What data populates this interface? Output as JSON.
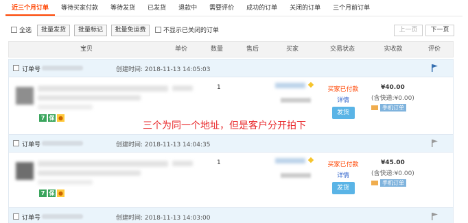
{
  "tabs": [
    {
      "label": "近三个月订单",
      "active": true
    },
    {
      "label": "等待买家付款",
      "active": false
    },
    {
      "label": "等待发货",
      "active": false
    },
    {
      "label": "已发货",
      "active": false
    },
    {
      "label": "退款中",
      "active": false
    },
    {
      "label": "需要评价",
      "active": false
    },
    {
      "label": "成功的订单",
      "active": false
    },
    {
      "label": "关闭的订单",
      "active": false
    },
    {
      "label": "三个月前订单",
      "active": false
    }
  ],
  "toolbar": {
    "select_all": "全选",
    "batch_ship": "批量发货",
    "batch_mark": "批量标记",
    "batch_free_shipping": "批量免运费",
    "hide_closed": "不显示已关闭的订单",
    "prev_page": "上一页",
    "next_page": "下一页"
  },
  "columns": [
    "宝贝",
    "单价",
    "数量",
    "售后",
    "买家",
    "交易状态",
    "实收款",
    "评价"
  ],
  "orders": [
    {
      "order_label": "订单号",
      "created": "创建时间: 2018-11-13 14:05:03",
      "qty": "1",
      "status": "买家已付款",
      "detail": "详情",
      "ship": "发货",
      "amount": "¥40.00",
      "postage": "(含快递:¥0.00)",
      "phone_order": "手机订单"
    },
    {
      "order_label": "订单号",
      "created": "创建时间: 2018-11-13 14:04:35",
      "qty": "1",
      "status": "买家已付款",
      "detail": "详情",
      "ship": "发货",
      "amount": "¥45.00",
      "postage": "(含快递:¥0.00)",
      "phone_order": "手机订单"
    },
    {
      "order_label": "订单号",
      "created": "创建时间: 2018-11-13 14:03:00"
    }
  ],
  "annotation": "三个为同一个地址，但是客户分开拍下",
  "colors": {
    "accent": "#ff4400",
    "link": "#3366cc",
    "ship_button": "#5ab4e6",
    "annotation": "#e8272a"
  }
}
